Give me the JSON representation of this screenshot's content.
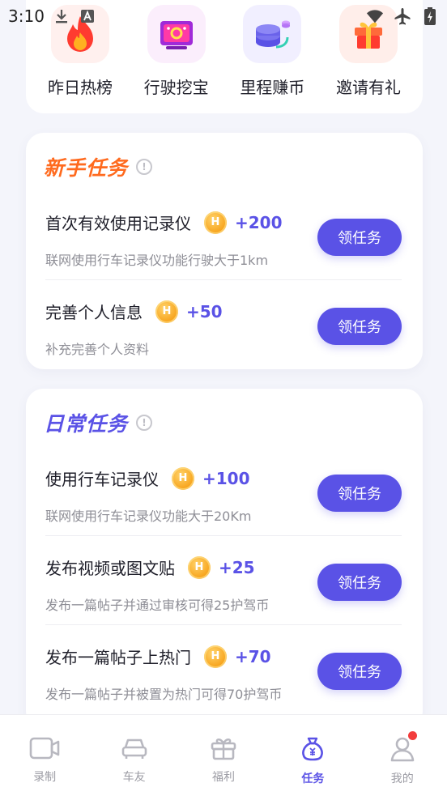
{
  "status_bar": {
    "time": "3:10"
  },
  "quick_actions": [
    {
      "label": "昨日热榜",
      "icon": "flame-icon"
    },
    {
      "label": "行驶挖宝",
      "icon": "treasure-screen-icon"
    },
    {
      "label": "里程赚币",
      "icon": "coin-stack-icon"
    },
    {
      "label": "邀请有礼",
      "icon": "gift-box-icon"
    }
  ],
  "newbie_tasks": {
    "title": "新手任务",
    "items": [
      {
        "title": "首次有效使用记录仪",
        "reward": "+200",
        "desc": "联网使用行车记录仪功能行驶大于1km",
        "button": "领任务"
      },
      {
        "title": "完善个人信息",
        "reward": "+50",
        "desc": "补充完善个人资料",
        "button": "领任务"
      }
    ]
  },
  "daily_tasks": {
    "title": "日常任务",
    "items": [
      {
        "title": "使用行车记录仪",
        "reward": "+100",
        "desc": "联网使用行车记录仪功能大于20Km",
        "button": "领任务"
      },
      {
        "title": "发布视频或图文贴",
        "reward": "+25",
        "desc": "发布一篇帖子并通过审核可得25护驾币",
        "button": "领任务"
      },
      {
        "title": "发布一篇帖子上热门",
        "reward": "+70",
        "desc": "发布一篇帖子并被置为热门可得70护驾币",
        "button": "领任务"
      }
    ]
  },
  "tab_bar": {
    "items": [
      {
        "label": "录制",
        "icon": "camera-icon"
      },
      {
        "label": "车友",
        "icon": "car-icon"
      },
      {
        "label": "福利",
        "icon": "gift-icon"
      },
      {
        "label": "任务",
        "icon": "money-bag-icon",
        "active": true
      },
      {
        "label": "我的",
        "icon": "person-icon",
        "badge": true
      }
    ]
  },
  "colors": {
    "accent": "#5a52e6",
    "orange": "#ff6a1e",
    "coin": "#f7a21a",
    "badge": "#f23c3c"
  }
}
